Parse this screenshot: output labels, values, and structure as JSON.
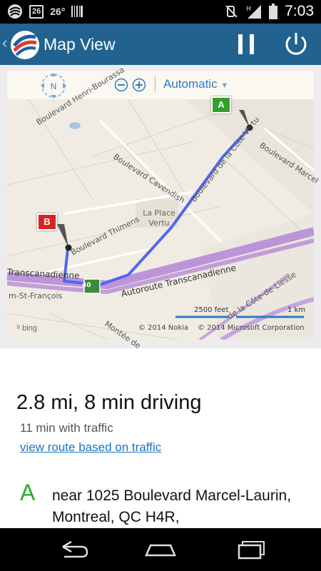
{
  "status_bar": {
    "notification_badge": "26",
    "temperature": "26°",
    "time": "7:03"
  },
  "action_bar": {
    "title": "Map View"
  },
  "map_toolbar": {
    "compass_label": "N",
    "mode": "Automatic"
  },
  "map": {
    "markers": {
      "start": "A",
      "end": "B"
    },
    "streets": [
      "Boulevard Henri-Bourassa",
      "Boulevard de la Côte-Vertu",
      "Boulevard Marcel",
      "Boulevard Cavendish",
      "Boulevard Thimens",
      "Transcanadienne",
      "Autoroute Transcanadienne",
      "m-St-François",
      "de la Côte-de-Liesse",
      "Montée de"
    ],
    "place": "La Place Vertu",
    "highway_shield": "40",
    "scale_feet": "2500 feet",
    "scale_km": "1 km",
    "attribution_nokia": "© 2014 Nokia",
    "attribution_microsoft": "© 2014 Microsoft Corporation",
    "provider": "bing",
    "route_color": "#5566ee",
    "highway_color": "#b78bd6"
  },
  "route": {
    "summary": "2.8 mi, 8 min driving",
    "traffic_time": "11 min with traffic",
    "traffic_link": "view route based on traffic",
    "waypoint_letter": "A",
    "waypoint_address": "near 1025 Boulevard Marcel-Laurin, Montreal, QC H4R,"
  }
}
